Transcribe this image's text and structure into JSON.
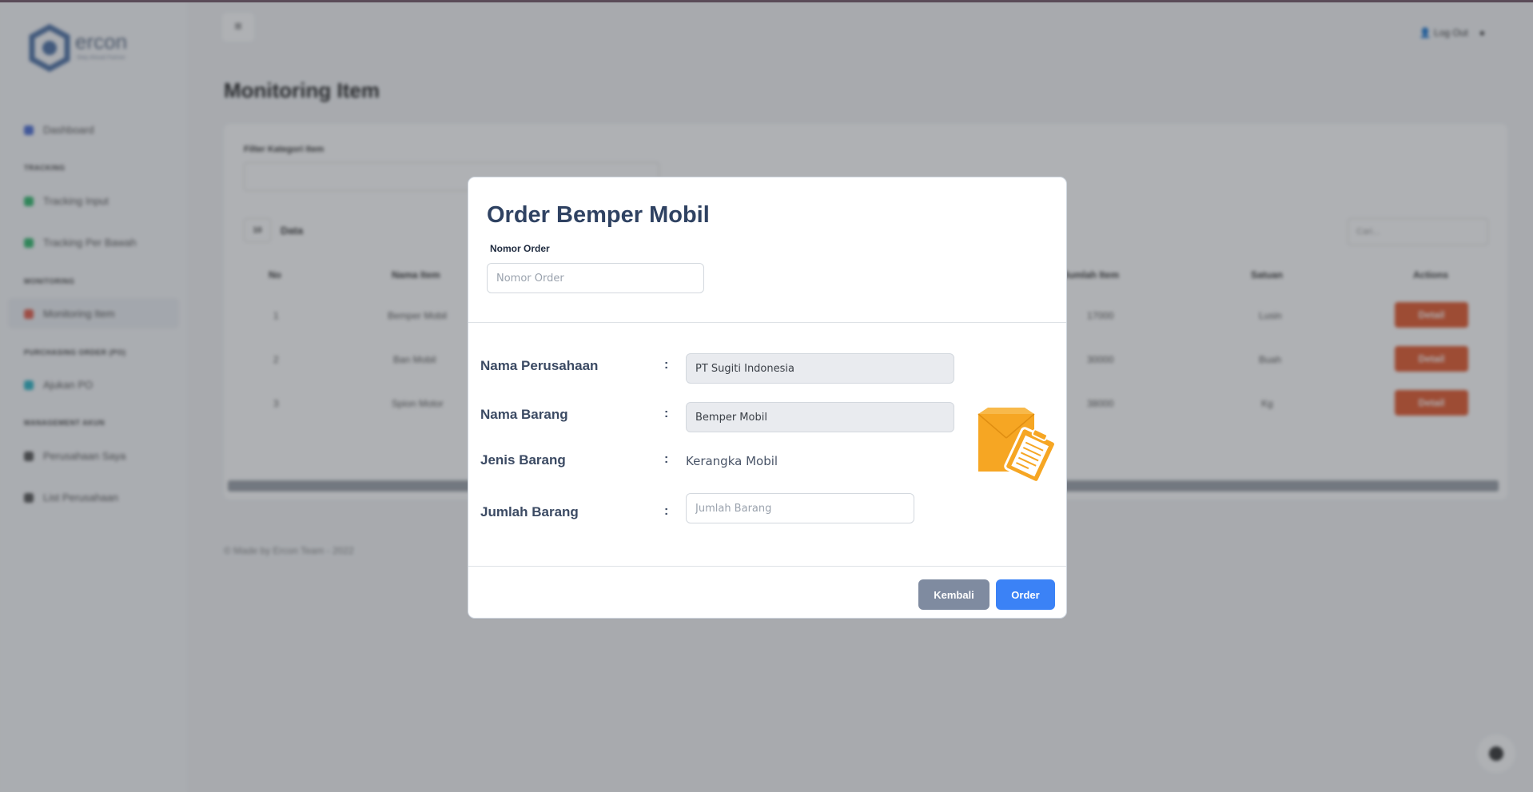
{
  "sidebar": {
    "logo_text": "ercon",
    "logo_sub": "Step Ahead Partner",
    "items": [
      {
        "label": "Dashboard",
        "color": "#4a6cd4"
      },
      {
        "label": "Tracking Input",
        "color": "#2fb86b"
      },
      {
        "label": "Tracking Per Bawah",
        "color": "#2fb86b"
      },
      {
        "label": "Monitoring Item",
        "color": "#e25c4a"
      },
      {
        "label": "Ajukan PO",
        "color": "#2bb3c4"
      },
      {
        "label": "Perusahaan Saya",
        "color": "#555555"
      },
      {
        "label": "List Perusahaan",
        "color": "#555555"
      }
    ],
    "sections": [
      "TRACKING",
      "MONITORING",
      "PURCHASING ORDER (PO)",
      "MANAGEMENT AKUN"
    ]
  },
  "header": {
    "menu_glyph": "≡",
    "user_label": "Log Out"
  },
  "page": {
    "title": "Monitoring Item",
    "filter_label": "Filter Kategori Item",
    "entries_value": "10",
    "entries_label": "Data",
    "search_placeholder": "Cari...",
    "columns": [
      "No",
      "Nama Item",
      "Jumlah Item",
      "Satuan",
      "Actions"
    ],
    "rows": [
      {
        "no": "1",
        "name": "Bemper Mobil",
        "qty": "17000",
        "unit": "Lusin",
        "action": "Detail"
      },
      {
        "no": "2",
        "name": "Ban Mobil",
        "qty": "30000",
        "unit": "Buah",
        "action": "Detail"
      },
      {
        "no": "3",
        "name": "Spion Motor",
        "qty": "38000",
        "unit": "Kg",
        "action": "Detail"
      }
    ],
    "footer": "© Made by Ercon Team - 2022"
  },
  "modal": {
    "title": "Order Bemper Mobil",
    "nomor_label": "Nomor Order",
    "nomor_placeholder": "Nomor Order",
    "fields": {
      "perusahaan_label": "Nama Perusahaan",
      "perusahaan_value": "PT Sugiti Indonesia",
      "barang_label": "Nama Barang",
      "barang_value": "Bemper Mobil",
      "jenis_label": "Jenis Barang",
      "jenis_value": "Kerangka Mobil",
      "jumlah_label": "Jumlah Barang",
      "jumlah_placeholder": "Jumlah Barang"
    },
    "colon": ":",
    "back_button": "Kembali",
    "order_button": "Order",
    "colors": {
      "title": "#2f4262",
      "order": "#3b82f6",
      "back": "#7f8ba0",
      "illustration": "#f6a623"
    }
  }
}
